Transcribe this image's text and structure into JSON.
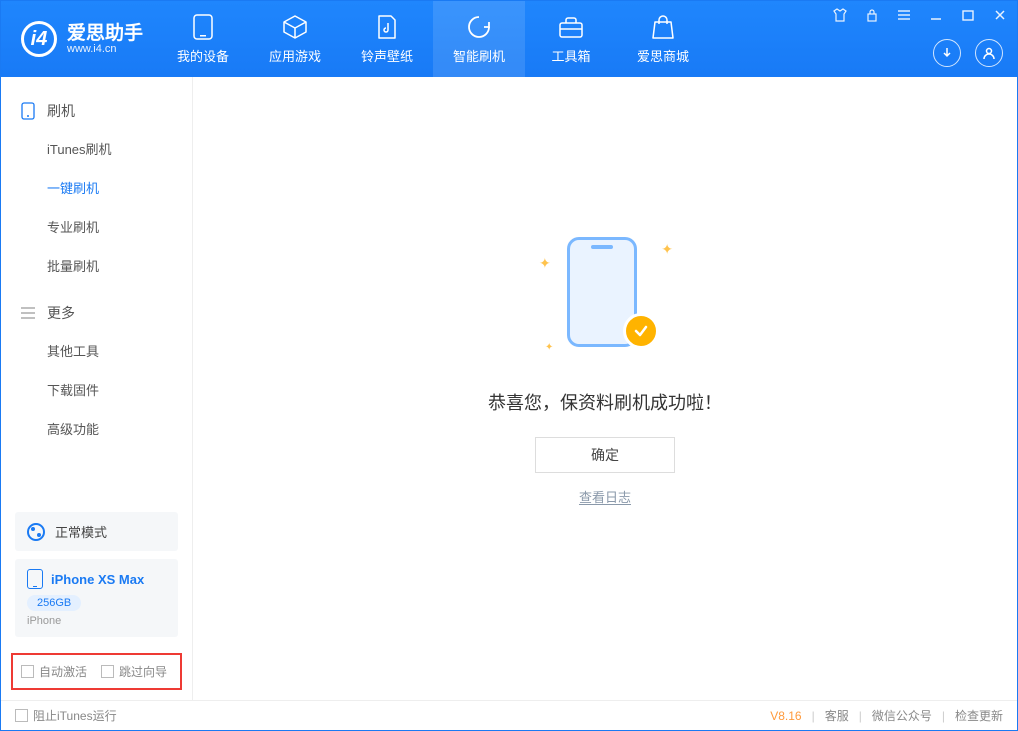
{
  "app": {
    "name_cn": "爱思助手",
    "name_en": "www.i4.cn"
  },
  "nav": [
    {
      "label": "我的设备"
    },
    {
      "label": "应用游戏"
    },
    {
      "label": "铃声壁纸"
    },
    {
      "label": "智能刷机"
    },
    {
      "label": "工具箱"
    },
    {
      "label": "爱思商城"
    }
  ],
  "sidebar": {
    "group1": {
      "title": "刷机",
      "items": [
        "iTunes刷机",
        "一键刷机",
        "专业刷机",
        "批量刷机"
      ]
    },
    "group2": {
      "title": "更多",
      "items": [
        "其他工具",
        "下载固件",
        "高级功能"
      ]
    }
  },
  "mode": {
    "label": "正常模式"
  },
  "device": {
    "name": "iPhone XS Max",
    "storage": "256GB",
    "type": "iPhone"
  },
  "checks": {
    "auto_activate": "自动激活",
    "skip_guide": "跳过向导"
  },
  "main": {
    "success_text": "恭喜您，保资料刷机成功啦！",
    "ok_btn": "确定",
    "view_log": "查看日志"
  },
  "footer": {
    "block_itunes": "阻止iTunes运行",
    "version": "V8.16",
    "links": [
      "客服",
      "微信公众号",
      "检查更新"
    ]
  }
}
